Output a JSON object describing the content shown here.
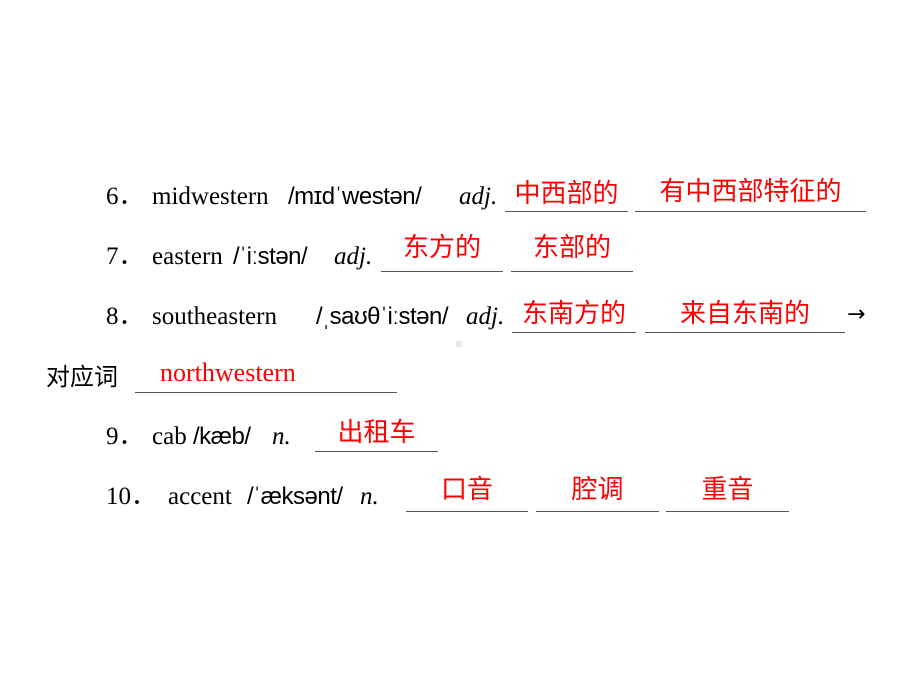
{
  "items": [
    {
      "number": "6．",
      "word": "midwestern",
      "phonetic": "/mɪdˈwestən/",
      "pos": "adj.",
      "answers": [
        "中西部的",
        "有中西部特征的"
      ]
    },
    {
      "number": "7．",
      "word": "eastern",
      "phonetic": "/ˈiːstən/",
      "pos": "adj.",
      "answers": [
        "东方的",
        "东部的"
      ]
    },
    {
      "number": "8．",
      "word": "southeastern",
      "phonetic": "/ˌsaʊθˈiːstən/",
      "pos": "adj.",
      "answers": [
        "东南方的",
        "来自东南的"
      ],
      "arrow": "→",
      "counterpart_label": "对应词",
      "counterpart_answer": "northwestern"
    },
    {
      "number": "9．",
      "word": "cab",
      "phonetic": "/kæb/",
      "pos": "n.",
      "answers": [
        "出租车"
      ]
    },
    {
      "number": "10．",
      "word": "accent",
      "phonetic": "/ˈæksənt/",
      "pos": "n.",
      "answers": [
        "口音",
        "腔调",
        "重音"
      ]
    }
  ],
  "colors": {
    "answer": "#ff0000",
    "text": "#000000",
    "underline": "#555555"
  }
}
